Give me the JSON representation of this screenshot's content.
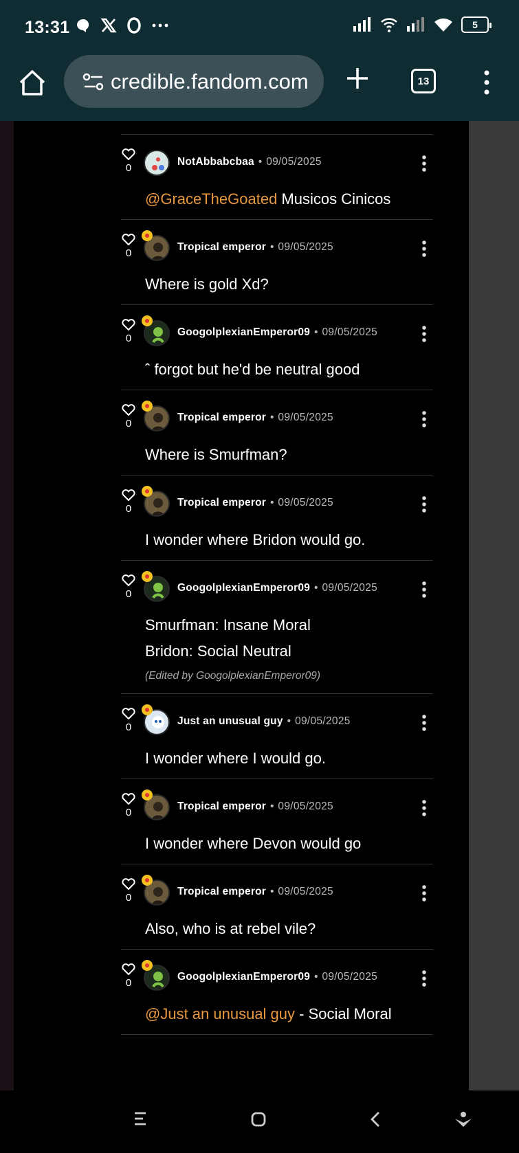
{
  "status_bar": {
    "time": "13:31",
    "left_icons": [
      "chat-bubble-icon",
      "x-logo-icon",
      "opera-icon",
      "more-dots-icon"
    ],
    "right_icons": [
      "signal-icon",
      "wifi-call-icon",
      "signal-2-icon",
      "wifi-icon",
      "battery-icon"
    ],
    "battery_level": "5"
  },
  "toolbar": {
    "url": "credible.fandom.com",
    "tab_count": "13"
  },
  "colors": {
    "toolbar_bg": "#0f2c33",
    "mention": "#e8983f",
    "badge": "#f2c01f"
  },
  "comments": [
    {
      "author": "NotAbbabcbaa",
      "date": "09/05/2025",
      "likes": "0",
      "lines": [
        {
          "mention": "@GraceTheGoated",
          "text": " Musicos Cinicos"
        }
      ],
      "edited": null,
      "badge": false
    },
    {
      "author": "Tropical emperor",
      "date": "09/05/2025",
      "likes": "0",
      "lines": [
        {
          "mention": null,
          "text": "Where is gold Xd?"
        }
      ],
      "edited": null,
      "badge": true
    },
    {
      "author": "GoogolplexianEmperor09",
      "date": "09/05/2025",
      "likes": "0",
      "lines": [
        {
          "mention": null,
          "text": "ˆ forgot but he'd be neutral good"
        }
      ],
      "edited": null,
      "badge": true
    },
    {
      "author": "Tropical emperor",
      "date": "09/05/2025",
      "likes": "0",
      "lines": [
        {
          "mention": null,
          "text": "Where is Smurfman?"
        }
      ],
      "edited": null,
      "badge": true
    },
    {
      "author": "Tropical emperor",
      "date": "09/05/2025",
      "likes": "0",
      "lines": [
        {
          "mention": null,
          "text": "I wonder where Bridon would go."
        }
      ],
      "edited": null,
      "badge": true
    },
    {
      "author": "GoogolplexianEmperor09",
      "date": "09/05/2025",
      "likes": "0",
      "lines": [
        {
          "mention": null,
          "text": "Smurfman: Insane Moral"
        },
        {
          "mention": null,
          "text": "Bridon: Social Neutral"
        }
      ],
      "edited": "(Edited by GoogolplexianEmperor09)",
      "badge": true
    },
    {
      "author": "Just an unusual guy",
      "date": "09/05/2025",
      "likes": "0",
      "lines": [
        {
          "mention": null,
          "text": "I wonder where I would go."
        }
      ],
      "edited": null,
      "badge": true
    },
    {
      "author": "Tropical emperor",
      "date": "09/05/2025",
      "likes": "0",
      "lines": [
        {
          "mention": null,
          "text": "I wonder where Devon would go"
        }
      ],
      "edited": null,
      "badge": true
    },
    {
      "author": "Tropical emperor",
      "date": "09/05/2025",
      "likes": "0",
      "lines": [
        {
          "mention": null,
          "text": "Also, who is at rebel vile?"
        }
      ],
      "edited": null,
      "badge": true
    },
    {
      "author": "GoogolplexianEmperor09",
      "date": "09/05/2025",
      "likes": "0",
      "lines": [
        {
          "mention": "@Just an unusual guy",
          "text": " - Social Moral"
        }
      ],
      "edited": null,
      "badge": true
    }
  ]
}
